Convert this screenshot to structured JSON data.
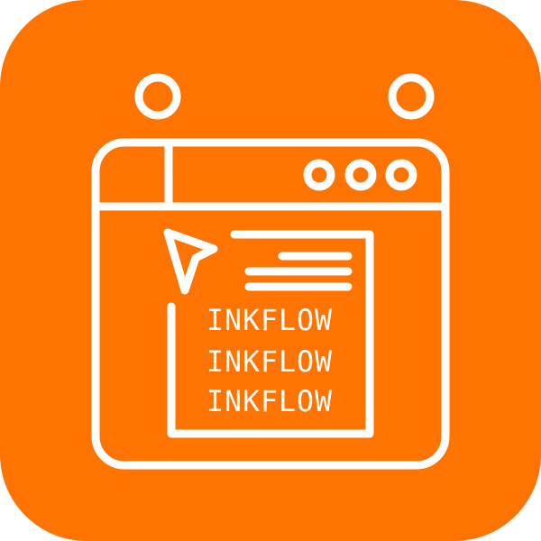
{
  "icon": {
    "name": "browser-window-icon",
    "background_color": "#ff7300",
    "line_color": "#ffffff",
    "words": [
      "INKFLOW",
      "INKFLOW",
      "INKFLOW"
    ]
  }
}
